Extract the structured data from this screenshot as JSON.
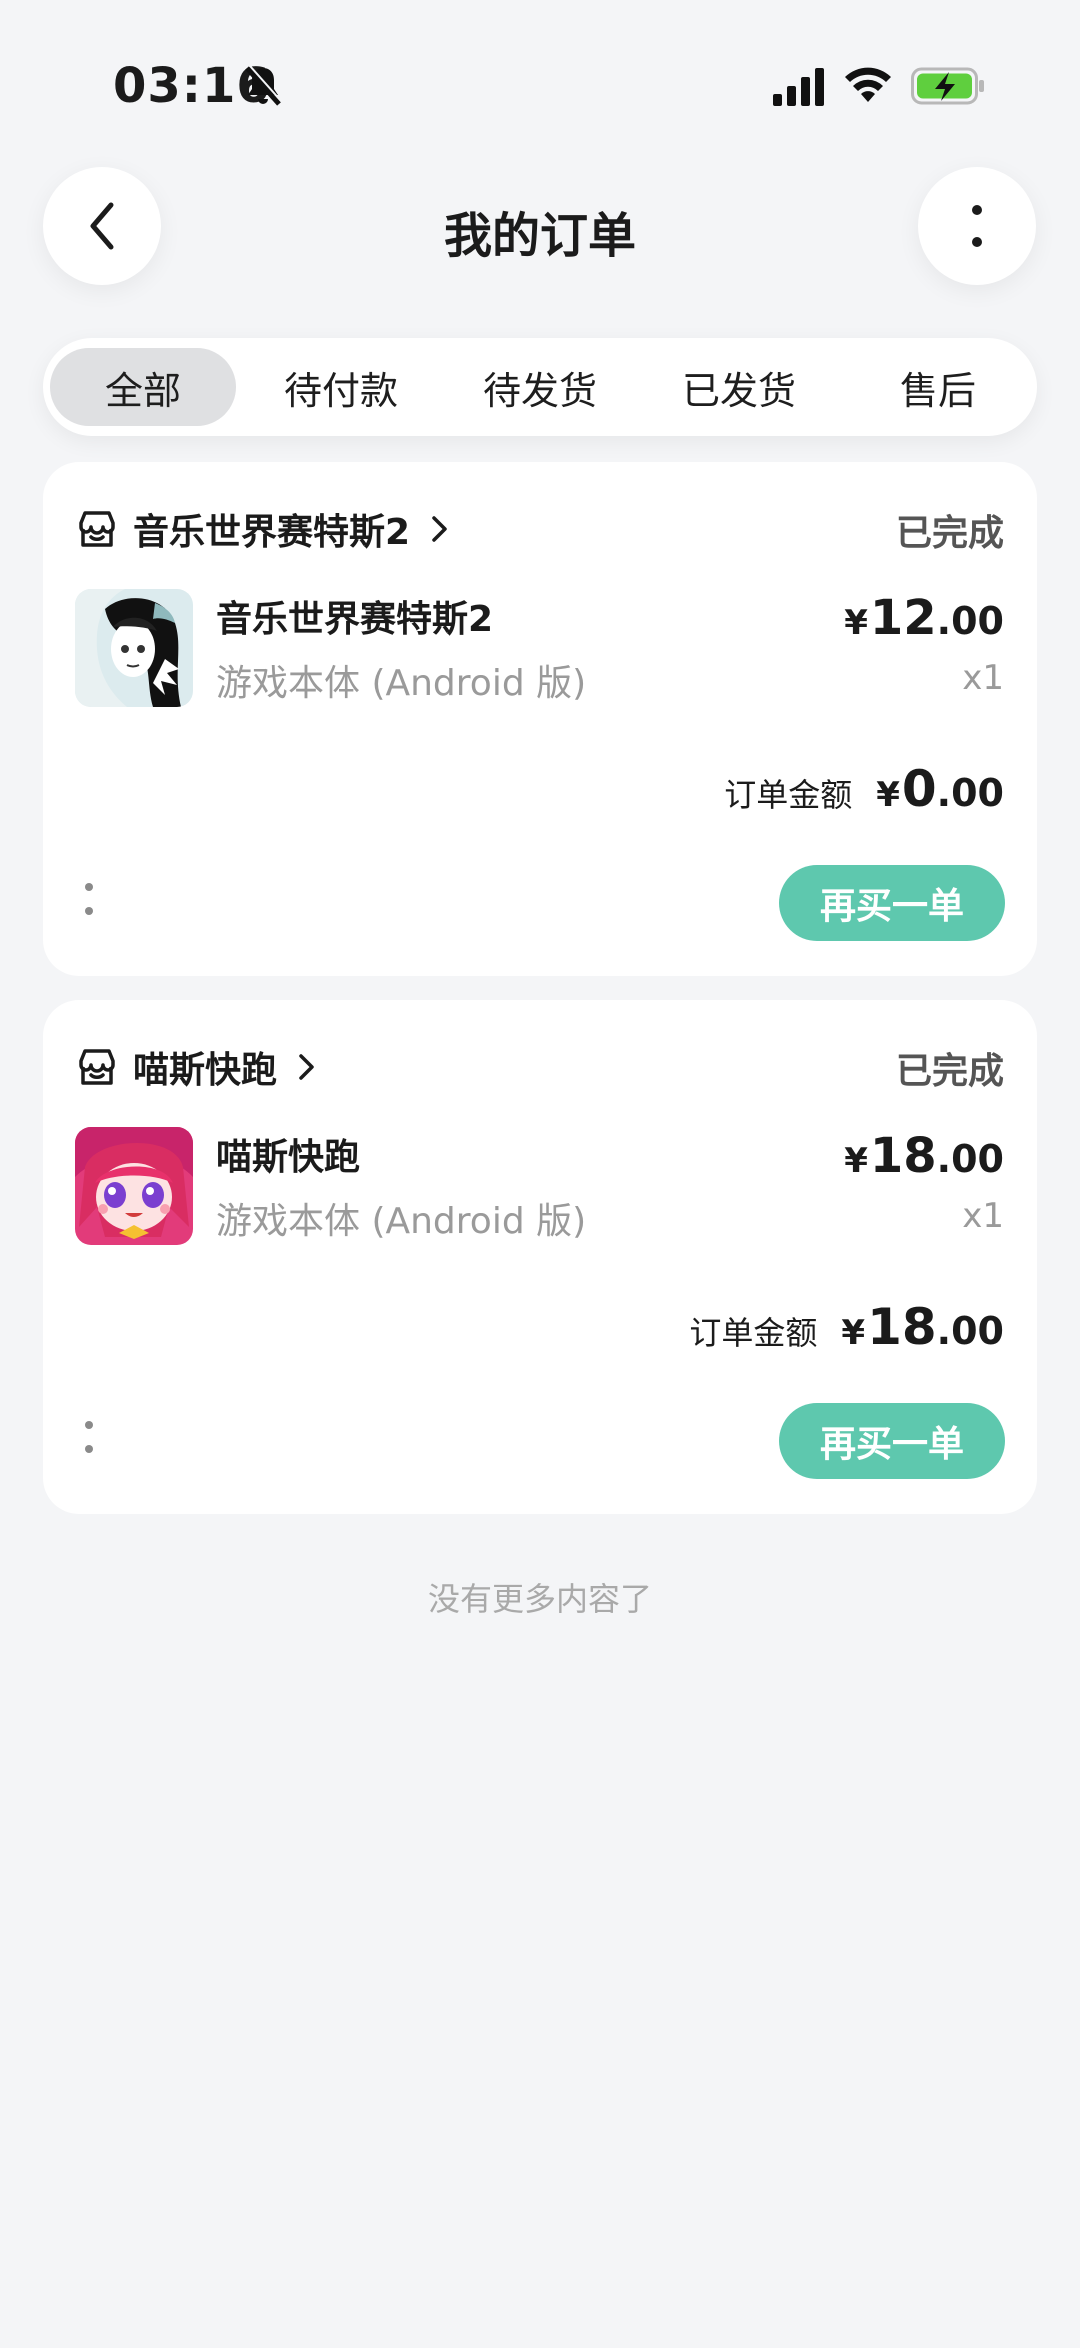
{
  "status_bar": {
    "time": "03:16"
  },
  "header": {
    "title": "我的订单"
  },
  "tabs": [
    {
      "label": "全部",
      "active": true
    },
    {
      "label": "待付款",
      "active": false
    },
    {
      "label": "待发货",
      "active": false
    },
    {
      "label": "已发货",
      "active": false
    },
    {
      "label": "售后",
      "active": false
    }
  ],
  "orders": [
    {
      "store": "音乐世界赛特斯2",
      "status": "已完成",
      "product_name": "音乐世界赛特斯2",
      "product_sub": "游戏本体 (Android 版)",
      "price_currency": "¥",
      "price_int": "12",
      "price_dec": ".00",
      "quantity": "x1",
      "total_label": "订单金额",
      "total_currency": "¥",
      "total_int": "0",
      "total_dec": ".00",
      "rebuy_label": "再买一单"
    },
    {
      "store": "喵斯快跑",
      "status": "已完成",
      "product_name": "喵斯快跑",
      "product_sub": "游戏本体 (Android 版)",
      "price_currency": "¥",
      "price_int": "18",
      "price_dec": ".00",
      "quantity": "x1",
      "total_label": "订单金额",
      "total_currency": "¥",
      "total_int": "18",
      "total_dec": ".00",
      "rebuy_label": "再买一单"
    }
  ],
  "footer": {
    "no_more": "没有更多内容了"
  },
  "colors": {
    "accent": "#5ec8ae",
    "background": "#f4f5f7"
  }
}
